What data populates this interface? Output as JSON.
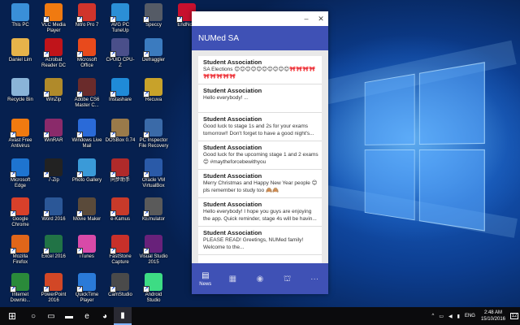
{
  "desktop": {
    "icons": [
      {
        "label": "This PC",
        "icon": "computer-icon",
        "color": "#3a8fd8"
      },
      {
        "label": "VLC Media Player",
        "icon": "vlc-icon",
        "color": "#f07a10"
      },
      {
        "label": "Nitro Pro 7",
        "icon": "nitro-icon",
        "color": "#d0342c"
      },
      {
        "label": "AVG PC TuneUp",
        "icon": "tuneup-icon",
        "color": "#2b8fd6"
      },
      {
        "label": "Speccy",
        "icon": "speccy-icon",
        "color": "#555b66"
      },
      {
        "label": "EndNote",
        "icon": "endnote-icon",
        "color": "#c8102e"
      },
      {
        "label": "Daniel Lim",
        "icon": "user-folder-icon",
        "color": "#e7b34a"
      },
      {
        "label": "Acrobat Reader DC",
        "icon": "acrobat-icon",
        "color": "#c0141a"
      },
      {
        "label": "Microsoft Office",
        "icon": "office-icon",
        "color": "#e84a1c"
      },
      {
        "label": "CPUID CPU-Z",
        "icon": "cpuz-icon",
        "color": "#4a4f8a"
      },
      {
        "label": "Defraggler",
        "icon": "defraggler-icon",
        "color": "#3b7bbf"
      },
      {
        "label": "Recycle Bin",
        "icon": "recycle-bin-icon",
        "color": "#8ab4d8"
      },
      {
        "label": "WinZip",
        "icon": "winzip-icon",
        "color": "#b08a2a"
      },
      {
        "label": "Adobe CS6 Master C...",
        "icon": "adobe-icon",
        "color": "#6a2b2b"
      },
      {
        "label": "Instashare",
        "icon": "instashare-icon",
        "color": "#1f8ad8"
      },
      {
        "label": "Recuva",
        "icon": "recuva-icon",
        "color": "#c8a22a"
      },
      {
        "label": "Avast Free Antivirus",
        "icon": "avast-icon",
        "color": "#f07a10"
      },
      {
        "label": "WinRAR",
        "icon": "winrar-icon",
        "color": "#8a2a6a"
      },
      {
        "label": "Windows Live Mail",
        "icon": "mail-icon",
        "color": "#2a6ad8"
      },
      {
        "label": "DOSBox 0.74",
        "icon": "dosbox-icon",
        "color": "#9a7a4a"
      },
      {
        "label": "PC Inspector File Recovery",
        "icon": "pc-inspector-icon",
        "color": "#3a6aa8"
      },
      {
        "label": "Microsoft Edge",
        "icon": "edge-icon",
        "color": "#1e74d0"
      },
      {
        "label": "7-Zip",
        "icon": "7zip-icon",
        "color": "#222222"
      },
      {
        "label": "Photo Gallery",
        "icon": "photo-gallery-icon",
        "color": "#3a9ad8"
      },
      {
        "label": "同步助手",
        "icon": "sync-helper-icon",
        "color": "#b02a2a"
      },
      {
        "label": "Oracle VM VirtualBox",
        "icon": "virtualbox-icon",
        "color": "#2a5aa8"
      },
      {
        "label": "Google Chrome",
        "icon": "chrome-icon",
        "color": "#d8402a"
      },
      {
        "label": "Word 2016",
        "icon": "word-icon",
        "color": "#2b5797"
      },
      {
        "label": "Movie Maker",
        "icon": "movie-maker-icon",
        "color": "#5a4a3a"
      },
      {
        "label": "e-Kamus",
        "icon": "ekamus-icon",
        "color": "#c83a2a"
      },
      {
        "label": "KEmulator",
        "icon": "kemulator-icon",
        "color": "#5a5a5a"
      },
      {
        "label": "Mozilla Firefox",
        "icon": "firefox-icon",
        "color": "#e0661a"
      },
      {
        "label": "Excel 2016",
        "icon": "excel-icon",
        "color": "#217346"
      },
      {
        "label": "iTunes",
        "icon": "itunes-icon",
        "color": "#d84aa8"
      },
      {
        "label": "FastStone Capture",
        "icon": "faststone-icon",
        "color": "#c8302a"
      },
      {
        "label": "Visual Studio 2015",
        "icon": "visual-studio-icon",
        "color": "#68217a"
      },
      {
        "label": "Internet Downlo...",
        "icon": "idm-icon",
        "color": "#2a8a3a"
      },
      {
        "label": "PowerPoint 2016",
        "icon": "powerpoint-icon",
        "color": "#d24726"
      },
      {
        "label": "QuickTime Player",
        "icon": "quicktime-icon",
        "color": "#2a7ad8"
      },
      {
        "label": "CamStudio",
        "icon": "camstudio-icon",
        "color": "#4a4a4a"
      },
      {
        "label": "Android Studio",
        "icon": "android-studio-icon",
        "color": "#3ddc84"
      }
    ]
  },
  "app": {
    "title": "NUMed SA",
    "window_controls": {
      "minimize": "–",
      "close": "✕"
    },
    "posts": [
      {
        "title": "Student Association",
        "body": "SA Elections 😊😊😊😊😊😊😊😊😊😊🎀🎀🎀🎀🎀🎀🎀🎀🎀"
      },
      {
        "title": "Student Association",
        "body": "Hello everybody! ..."
      },
      {
        "title": "Student Association",
        "body": "Good luck to stage 1s and 2s for your exams tomorrow!! Don't forget to have a good night's..."
      },
      {
        "title": "Student Association",
        "body": "Good luck for the upcoming stage 1 and 2 exams 😊 #maytheforcebewithyou"
      },
      {
        "title": "Student Association",
        "body": "Merry Christmas and Happy New Year people 😊 pls remember to study too 🙈🙈"
      },
      {
        "title": "Student Association",
        "body": "Hello everybody! I hope you guys are enjoying the app. Quick reminder, stage 4s will be havin..."
      },
      {
        "title": "Student Association",
        "body": "PLEASE READ! Greetings, NUMed family! Welcome to the..."
      }
    ],
    "nav": [
      {
        "label": "News",
        "icon": "news-icon",
        "glyph": "▤",
        "active": true
      },
      {
        "label": "",
        "icon": "calendar-icon",
        "glyph": "▦",
        "active": false
      },
      {
        "label": "",
        "icon": "profile-icon",
        "glyph": "◉",
        "active": false
      },
      {
        "label": "",
        "icon": "building-icon",
        "glyph": "⛫",
        "active": false
      },
      {
        "label": "",
        "icon": "more-icon",
        "glyph": "···",
        "active": false
      }
    ],
    "colors": {
      "primary": "#3f51b5"
    }
  },
  "taskbar": {
    "start_glyph": "⊞",
    "search_glyph": "○",
    "task_view_glyph": "▭",
    "apps": [
      {
        "icon": "file-explorer-icon",
        "glyph": "▬"
      },
      {
        "icon": "edge-icon",
        "glyph": "e"
      },
      {
        "icon": "chrome-icon",
        "glyph": "◕"
      },
      {
        "icon": "numed-app-icon",
        "glyph": "▮"
      }
    ],
    "tray": {
      "chevron": "^",
      "language": "ENG",
      "time": "2:48 AM",
      "date": "15/10/2016",
      "notification_count": "12"
    }
  }
}
